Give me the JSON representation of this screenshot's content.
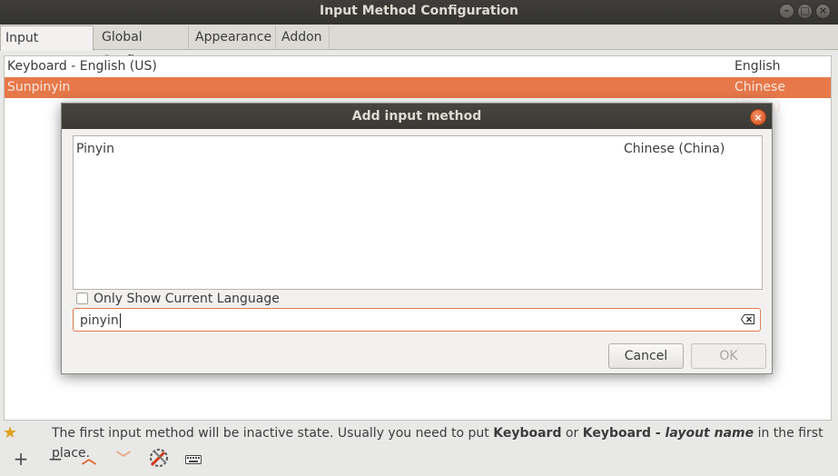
{
  "window": {
    "title": "Input Method Configuration"
  },
  "tabs": [
    {
      "label": "Input Method"
    },
    {
      "label": "Global Config"
    },
    {
      "label": "Appearance"
    },
    {
      "label": "Addon"
    }
  ],
  "input_methods": [
    {
      "name": "Keyboard - English (US)",
      "language": "English"
    },
    {
      "name": "Sunpinyin",
      "language": "Chinese (China)"
    }
  ],
  "hint": {
    "prefix": "The first input method will be inactive state. Usually you need to put ",
    "bold1": "Keyboard",
    "middle": " or ",
    "bold2": "Keyboard - ",
    "italic": "layout name",
    "suffix": " in the first place."
  },
  "toolbar": {
    "add": "+",
    "remove": "−",
    "up": "︿",
    "down": "﹀"
  },
  "dialog": {
    "title": "Add input method",
    "results": [
      {
        "name": "Pinyin",
        "language": "Chinese (China)"
      }
    ],
    "only_current_language_label": "Only Show Current Language",
    "search_value": "pinyin",
    "cancel_label": "Cancel",
    "ok_label": "OK"
  },
  "colors": {
    "selection": "#e6784a",
    "accent": "#e07c4e",
    "titlebar": "#3c3b37"
  }
}
